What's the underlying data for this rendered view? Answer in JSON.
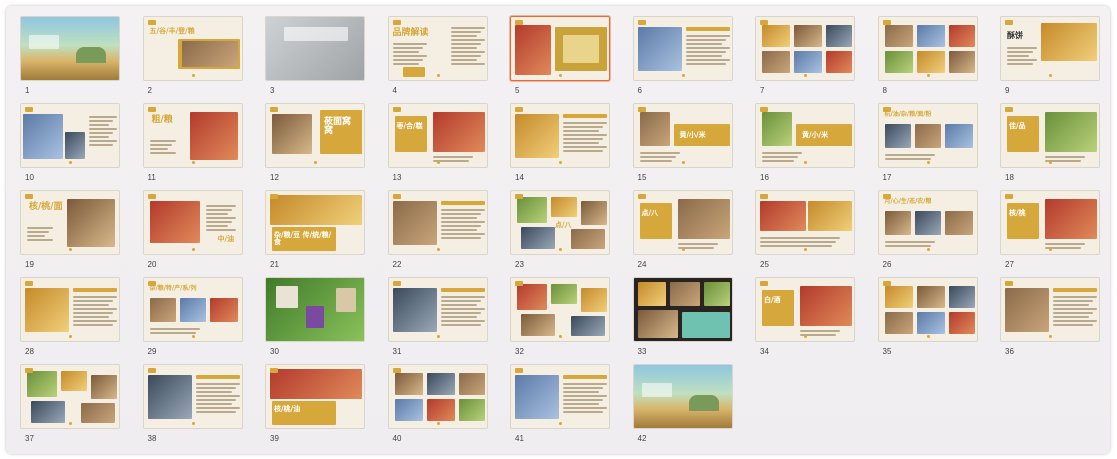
{
  "colors": {
    "accent": "#d6a83b",
    "selection": "#e36b3a",
    "slide_bg": "#f5efe3"
  },
  "selected_slide": "5",
  "slides": [
    {
      "number": "1",
      "layout": "landscape",
      "title": ""
    },
    {
      "number": "2",
      "layout": "title-photo",
      "title": "五/谷/丰/登/粮"
    },
    {
      "number": "3",
      "layout": "office-photo",
      "title": ""
    },
    {
      "number": "4",
      "layout": "text-page",
      "title": "品牌解读"
    },
    {
      "number": "5",
      "layout": "two-photos",
      "title": ""
    },
    {
      "number": "6",
      "layout": "photo-text",
      "title": ""
    },
    {
      "number": "7",
      "layout": "photo-grid",
      "title": ""
    },
    {
      "number": "8",
      "layout": "photo-grid",
      "title": ""
    },
    {
      "number": "9",
      "layout": "photo-right",
      "title": "酥饼"
    },
    {
      "number": "10",
      "layout": "warehouse",
      "title": ""
    },
    {
      "number": "11",
      "layout": "title-block",
      "title": "粗/粮"
    },
    {
      "number": "12",
      "layout": "block-right",
      "title": "莜面窝窝"
    },
    {
      "number": "13",
      "layout": "block-left",
      "title": "枣/合/糕"
    },
    {
      "number": "14",
      "layout": "photo-text",
      "title": ""
    },
    {
      "number": "15",
      "layout": "banner",
      "title": "黄/小/米"
    },
    {
      "number": "16",
      "layout": "banner",
      "title": "黄/小/米"
    },
    {
      "number": "17",
      "layout": "title-row",
      "title": "杭/油/杂/粮/面/粉"
    },
    {
      "number": "18",
      "layout": "block-left",
      "title": "佳/品"
    },
    {
      "number": "19",
      "layout": "title-block",
      "title": "核/桃/面"
    },
    {
      "number": "20",
      "layout": "red-photo",
      "title": "中/油"
    },
    {
      "number": "21",
      "layout": "block-bottom",
      "title": "杂/粮/豆 传/统/粮/食"
    },
    {
      "number": "22",
      "layout": "photo-text",
      "title": ""
    },
    {
      "number": "23",
      "layout": "collage",
      "title": "点/八"
    },
    {
      "number": "24",
      "layout": "block-left",
      "title": "点/八"
    },
    {
      "number": "25",
      "layout": "photo-row",
      "title": ""
    },
    {
      "number": "26",
      "layout": "title-row",
      "title": "月/心/生/态/农/粮"
    },
    {
      "number": "27",
      "layout": "block-left",
      "title": "核/桃"
    },
    {
      "number": "28",
      "layout": "photo-text",
      "title": ""
    },
    {
      "number": "29",
      "layout": "title-row",
      "title": "杂/粮/特/产/系/列"
    },
    {
      "number": "30",
      "layout": "green-photo",
      "title": ""
    },
    {
      "number": "31",
      "layout": "photo-text",
      "title": ""
    },
    {
      "number": "32",
      "layout": "collage",
      "title": ""
    },
    {
      "number": "33",
      "layout": "dark-collage",
      "title": ""
    },
    {
      "number": "34",
      "layout": "block-left",
      "title": "白/酒"
    },
    {
      "number": "35",
      "layout": "photo-grid",
      "title": ""
    },
    {
      "number": "36",
      "layout": "photo-text",
      "title": ""
    },
    {
      "number": "37",
      "layout": "collage",
      "title": ""
    },
    {
      "number": "38",
      "layout": "photo-text",
      "title": ""
    },
    {
      "number": "39",
      "layout": "block-bottom",
      "title": "核/桃/油"
    },
    {
      "number": "40",
      "layout": "photo-grid",
      "title": ""
    },
    {
      "number": "41",
      "layout": "photo-text",
      "title": ""
    },
    {
      "number": "42",
      "layout": "landscape",
      "title": ""
    }
  ]
}
